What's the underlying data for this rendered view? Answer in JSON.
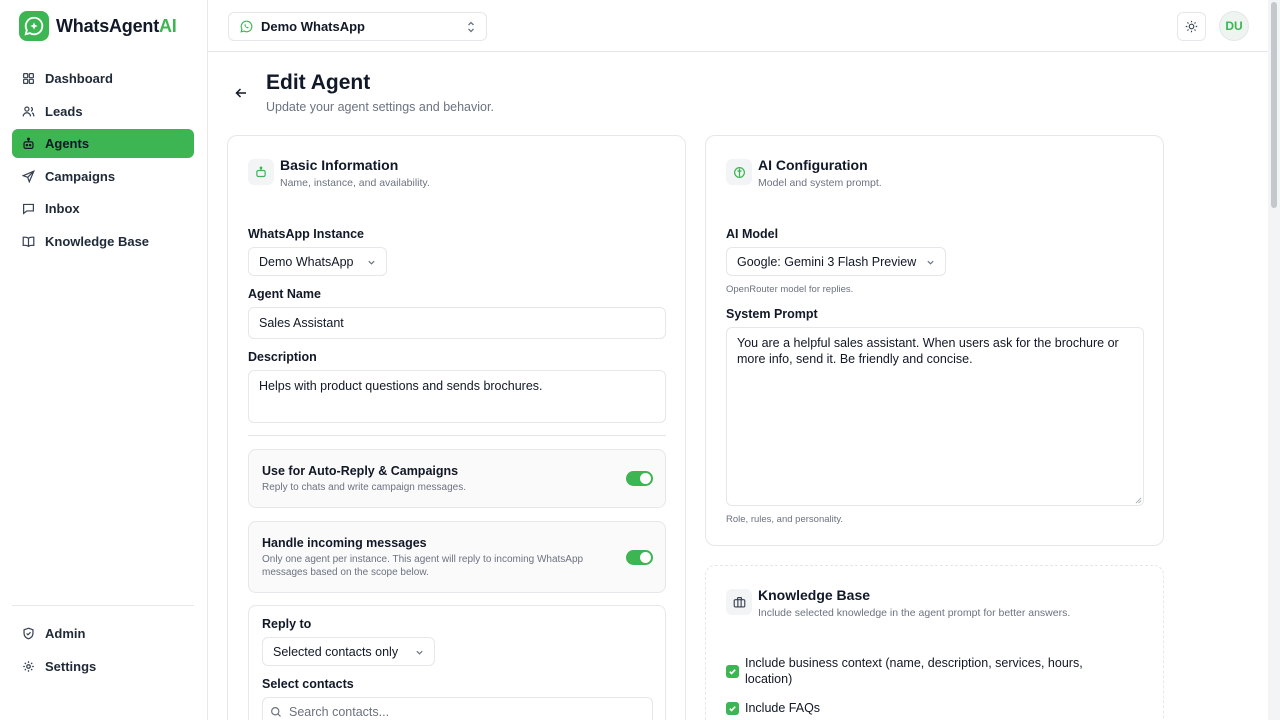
{
  "brand": {
    "name_main": "WhatsAgent",
    "name_accent": "AI",
    "color": "#3cb552"
  },
  "sidebar": {
    "items": [
      {
        "label": "Dashboard",
        "icon": "grid-icon"
      },
      {
        "label": "Leads",
        "icon": "users-icon"
      },
      {
        "label": "Agents",
        "icon": "bot-icon",
        "active": true
      },
      {
        "label": "Campaigns",
        "icon": "send-icon"
      },
      {
        "label": "Inbox",
        "icon": "message-icon"
      },
      {
        "label": "Knowledge Base",
        "icon": "book-icon"
      }
    ],
    "bottom_items": [
      {
        "label": "Admin",
        "icon": "shield-icon"
      },
      {
        "label": "Settings",
        "icon": "gear-icon"
      }
    ]
  },
  "header": {
    "instance_value": "Demo WhatsApp",
    "avatar_initials": "DU"
  },
  "page": {
    "title": "Edit Agent",
    "subtitle": "Update your agent settings and behavior."
  },
  "basic": {
    "title": "Basic Information",
    "subtitle": "Name, instance, and availability.",
    "instance_label": "WhatsApp Instance",
    "instance_value": "Demo WhatsApp",
    "name_label": "Agent Name",
    "name_value": "Sales Assistant",
    "desc_label": "Description",
    "desc_value": "Helps with product questions and sends brochures.",
    "auto_reply_title": "Use for Auto-Reply & Campaigns",
    "auto_reply_desc": "Reply to chats and write campaign messages.",
    "auto_reply_on": true,
    "incoming_title": "Handle incoming messages",
    "incoming_desc": "Only one agent per instance. This agent will reply to incoming WhatsApp messages based on the scope below.",
    "incoming_on": true,
    "reply_to_label": "Reply to",
    "reply_to_value": "Selected contacts only",
    "select_contacts_label": "Select contacts",
    "search_placeholder": "Search contacts..."
  },
  "ai": {
    "title": "AI Configuration",
    "subtitle": "Model and system prompt.",
    "model_label": "AI Model",
    "model_value": "Google: Gemini 3 Flash Preview",
    "model_hint": "OpenRouter model for replies.",
    "prompt_label": "System Prompt",
    "prompt_value": "You are a helpful sales assistant. When users ask for the brochure or more info, send it. Be friendly and concise.",
    "prompt_hint": "Role, rules, and personality."
  },
  "kb": {
    "title": "Knowledge Base",
    "subtitle": "Include selected knowledge in the agent prompt for better answers.",
    "opt_business": "Include business context (name, description, services, hours, location)",
    "opt_faqs": "Include FAQs"
  }
}
